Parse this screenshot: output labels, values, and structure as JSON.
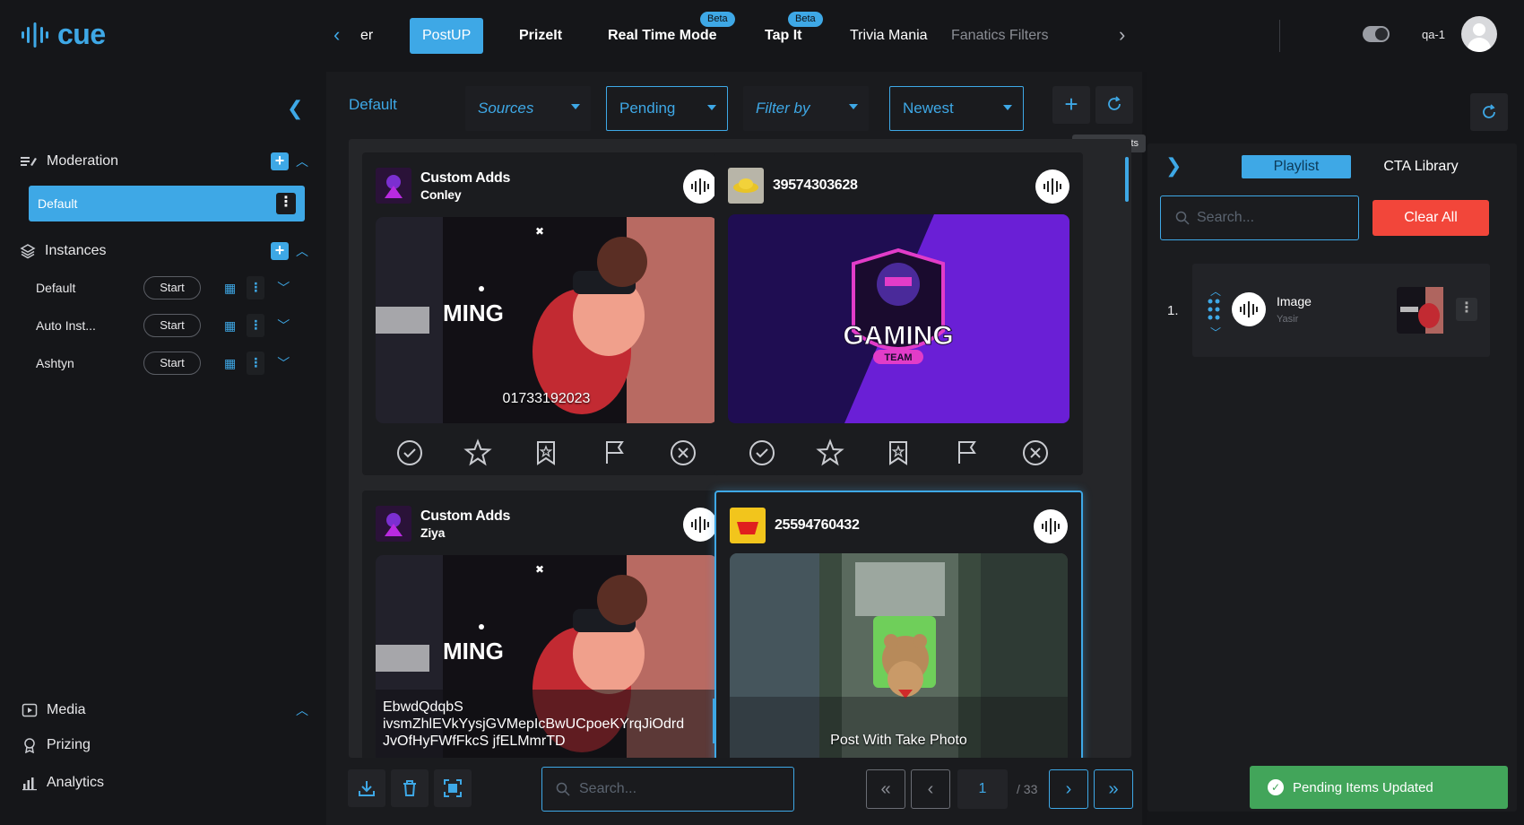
{
  "app": {
    "logo_text": "cue"
  },
  "sidebar": {
    "moderation_label": "Moderation",
    "default_item_label": "Default",
    "instances_label": "Instances",
    "instances": [
      {
        "name": "Default",
        "start_label": "Start"
      },
      {
        "name": "Auto Inst...",
        "start_label": "Start"
      },
      {
        "name": "Ashtyn",
        "start_label": "Start"
      }
    ],
    "bottom_nav": [
      {
        "label": "Media",
        "icon": "media-icon"
      },
      {
        "label": "Prizing",
        "icon": "prizing-icon"
      },
      {
        "label": "Analytics",
        "icon": "analytics-icon"
      }
    ]
  },
  "topbar": {
    "tabs": [
      {
        "label": "er",
        "active": false
      },
      {
        "label": "PostUP",
        "active": true
      },
      {
        "label": "PrizeIt",
        "active": false
      },
      {
        "label": "Real Time Mode",
        "active": false,
        "badge": "Beta"
      },
      {
        "label": "Tap It",
        "active": false,
        "badge": "Beta"
      },
      {
        "label": "Trivia Mania",
        "active": false
      },
      {
        "label": "Fanatics Filters",
        "active": false
      }
    ],
    "user_name": "qa-1"
  },
  "filters": {
    "default_label": "Default",
    "sources": "Sources",
    "status": "Pending",
    "filter_by": "Filter by",
    "sort": "Newest",
    "tooltip": "Update Posts"
  },
  "posts": [
    {
      "title": "Custom Adds",
      "subtitle": "Conley",
      "caption": "01733192023"
    },
    {
      "title": "39574303628",
      "subtitle": "",
      "caption": "",
      "image_text": "GAMING",
      "image_subtext": "TEAM"
    },
    {
      "title": "Custom Adds",
      "subtitle": "Ziya",
      "caption_lines": [
        "EbwdQdqbS",
        "ivsmZhlEVkYysjGVMepIcBwUCpoeKYrqJiOdrd",
        "JvOfHyFWfFkcS jfELMmrTD"
      ]
    },
    {
      "title": "25594760432",
      "subtitle": "",
      "caption": "Post With Take Photo"
    }
  ],
  "gaming_overlay_text": "MING",
  "bottom": {
    "search_placeholder": "Search...",
    "page": "1",
    "total_pages": "/ 33"
  },
  "playlist": {
    "tabs": [
      "Playlist",
      "CTA Library"
    ],
    "search_placeholder": "Search...",
    "clear_label": "Clear All",
    "items": [
      {
        "index": "1.",
        "title": "Image",
        "author": "Yasir"
      }
    ]
  },
  "toast": {
    "message": "Pending Items Updated"
  },
  "colors": {
    "accent": "#3ea8e6",
    "danger": "#f2463a",
    "success": "#42a55a"
  }
}
